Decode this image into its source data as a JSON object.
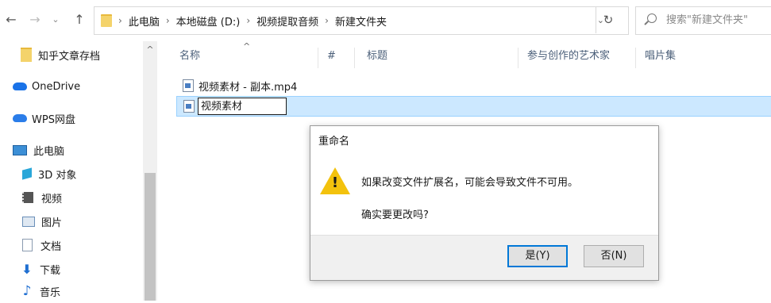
{
  "address_bar": {
    "breadcrumbs": [
      "此电脑",
      "本地磁盘 (D:)",
      "视频提取音频",
      "新建文件夹"
    ],
    "search_placeholder": "搜索\"新建文件夹\""
  },
  "sidebar": {
    "items": [
      {
        "label": "知乎文章存档",
        "icon": "folder-icon",
        "color": "#f4d36b"
      },
      {
        "label": "OneDrive",
        "icon": "cloud-icon",
        "color": "#1a73e8"
      },
      {
        "label": "WPS网盘",
        "icon": "cloud-icon",
        "color": "#2b7de9"
      },
      {
        "label": "此电脑",
        "icon": "computer-icon",
        "color": "#3c8fd6"
      },
      {
        "label": "3D 对象",
        "icon": "cube-icon",
        "color": "#2aa7d9"
      },
      {
        "label": "视频",
        "icon": "video-icon",
        "color": "#555555"
      },
      {
        "label": "图片",
        "icon": "picture-icon",
        "color": "#6a8fb8"
      },
      {
        "label": "文档",
        "icon": "document-icon",
        "color": "#8a9bb0"
      },
      {
        "label": "下载",
        "icon": "download-icon",
        "color": "#1f6fd1"
      },
      {
        "label": "音乐",
        "icon": "music-icon",
        "color": "#1f6fd1"
      }
    ]
  },
  "columns": [
    "名称",
    "#",
    "标题",
    "参与创作的艺术家",
    "唱片集"
  ],
  "files": [
    {
      "name": "视频素材 - 副本.mp4",
      "selected": false
    },
    {
      "name": "视频素材",
      "selected": true,
      "renaming": true
    }
  ],
  "dialog": {
    "title": "重命名",
    "message": "如果改变文件扩展名，可能会导致文件不可用。",
    "question": "确实要更改吗?",
    "yes_label": "是(Y)",
    "no_label": "否(N)",
    "accent": "#0078d7",
    "warning_color": "#f3c20d"
  }
}
